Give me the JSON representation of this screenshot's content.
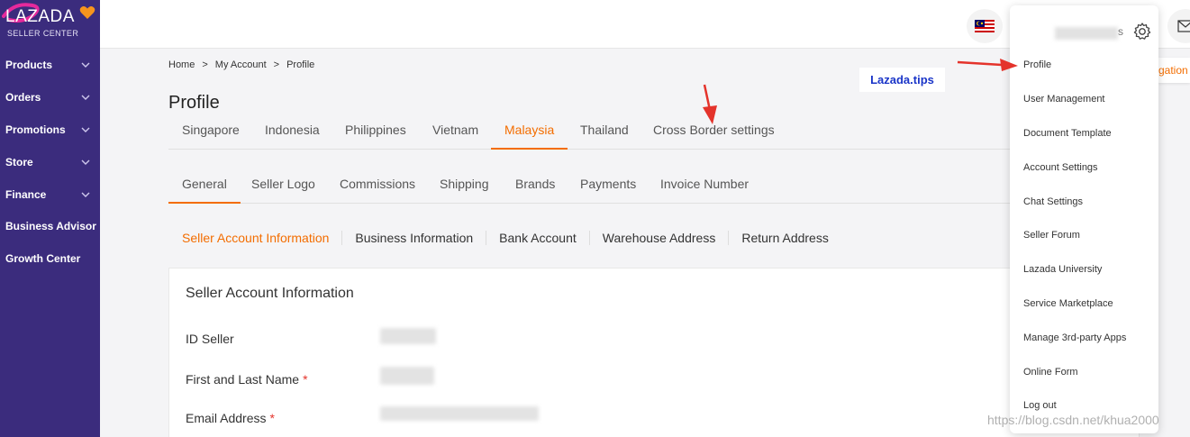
{
  "brand": {
    "logo_text": "LAZADA",
    "logo_sub": "SELLER CENTER"
  },
  "sidebar": {
    "items": [
      {
        "label": "Products",
        "has_chevron": true
      },
      {
        "label": "Orders",
        "has_chevron": true
      },
      {
        "label": "Promotions",
        "has_chevron": true
      },
      {
        "label": "Store",
        "has_chevron": true
      },
      {
        "label": "Finance",
        "has_chevron": true
      },
      {
        "label": "Business Advisor",
        "has_chevron": false
      },
      {
        "label": "Growth Center",
        "has_chevron": false
      }
    ]
  },
  "breadcrumb": {
    "items": [
      "Home",
      ">",
      "My Account",
      ">",
      "Profile"
    ]
  },
  "page_title": "Profile",
  "country_tabs": [
    "Singapore",
    "Indonesia",
    "Philippines",
    "Vietnam",
    "Malaysia",
    "Thailand",
    "Cross Border settings"
  ],
  "active_country": "Malaysia",
  "section_tabs": [
    "General",
    "Seller Logo",
    "Commissions",
    "Shipping",
    "Brands",
    "Payments",
    "Invoice Number"
  ],
  "active_section": "General",
  "sub_tabs": [
    "Seller Account Information",
    "Business Information",
    "Bank Account",
    "Warehouse Address",
    "Return Address"
  ],
  "active_sub": "Seller Account Information",
  "card": {
    "title": "Seller Account Information",
    "fields": [
      {
        "label": "ID Seller",
        "required": false
      },
      {
        "label": "First and Last Name",
        "required": true
      },
      {
        "label": "Email Address",
        "required": true
      }
    ]
  },
  "tips_label": "Lazada.tips",
  "dropdown": {
    "user_suffix": "s",
    "items": [
      "Profile",
      "User Management",
      "Document Template",
      "Account Settings",
      "Chat Settings",
      "Seller Forum",
      "Lazada University",
      "Service Marketplace",
      "Manage 3rd-party Apps",
      "Online Form",
      "Log out"
    ]
  },
  "orange_peek_text": "gation",
  "watermark": "https://blog.csdn.net/khua2000",
  "colors": {
    "sidebar": "#3b2c7d",
    "accent": "#f36d00",
    "arrow": "#e4332b",
    "tips": "#1a35c8"
  },
  "icons": [
    "malaysia-flag-icon",
    "mail-icon",
    "gear-icon",
    "chevron-down-icon",
    "lazada-heart-icon"
  ]
}
